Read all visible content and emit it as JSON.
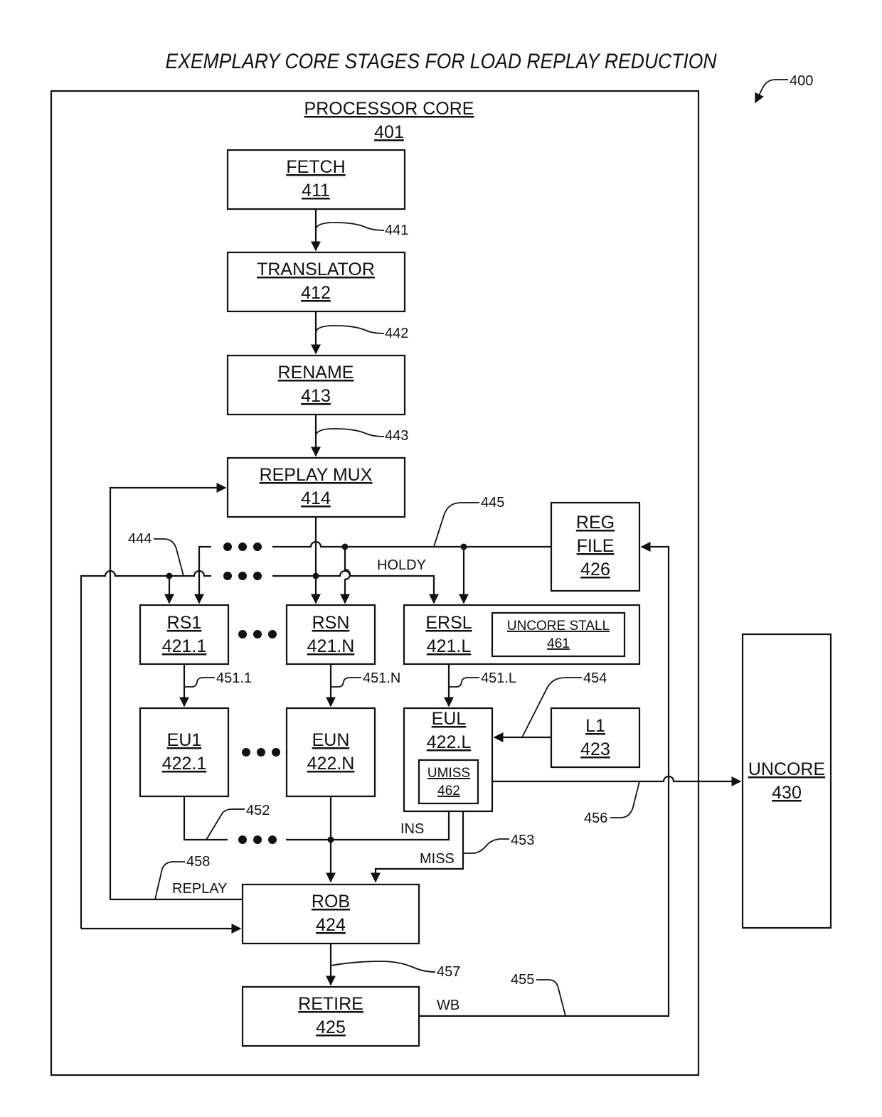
{
  "title": "EXEMPLARY CORE STAGES FOR LOAD REPLAY REDUCTION",
  "figure_ref": "400",
  "processor_core": {
    "name": "PROCESSOR CORE",
    "ref": "401"
  },
  "blocks": {
    "fetch": {
      "name": "FETCH",
      "ref": "411"
    },
    "translator": {
      "name": "TRANSLATOR",
      "ref": "412"
    },
    "rename": {
      "name": "RENAME",
      "ref": "413"
    },
    "replay_mux": {
      "name": "REPLAY MUX",
      "ref": "414"
    },
    "reg_file": {
      "name_line1": "REG",
      "name_line2": "FILE",
      "ref": "426"
    },
    "rs1": {
      "name": "RS1",
      "ref": "421.1"
    },
    "rsn": {
      "name": "RSN",
      "ref": "421.N"
    },
    "ersl": {
      "name": "ERSL",
      "ref": "421.L"
    },
    "uncore_stall": {
      "name": "UNCORE STALL",
      "ref": "461"
    },
    "eu1": {
      "name": "EU1",
      "ref": "422.1"
    },
    "eun": {
      "name": "EUN",
      "ref": "422.N"
    },
    "eul": {
      "name": "EUL",
      "ref": "422.L"
    },
    "umiss": {
      "name": "UMISS",
      "ref": "462"
    },
    "l1": {
      "name": "L1",
      "ref": "423"
    },
    "rob": {
      "name": "ROB",
      "ref": "424"
    },
    "retire": {
      "name": "RETIRE",
      "ref": "425"
    },
    "uncore": {
      "name": "UNCORE",
      "ref": "430"
    }
  },
  "signal_refs": {
    "r441": "441",
    "r442": "442",
    "r443": "443",
    "r444": "444",
    "r445": "445",
    "r451_1": "451.1",
    "r451_n": "451.N",
    "r451_l": "451.L",
    "r452": "452",
    "r453": "453",
    "r454": "454",
    "r455": "455",
    "r456": "456",
    "r457": "457",
    "r458": "458"
  },
  "signal_labels": {
    "holdy": "HOLDY",
    "ins": "INS",
    "miss": "MISS",
    "replay": "REPLAY",
    "wb": "WB"
  }
}
